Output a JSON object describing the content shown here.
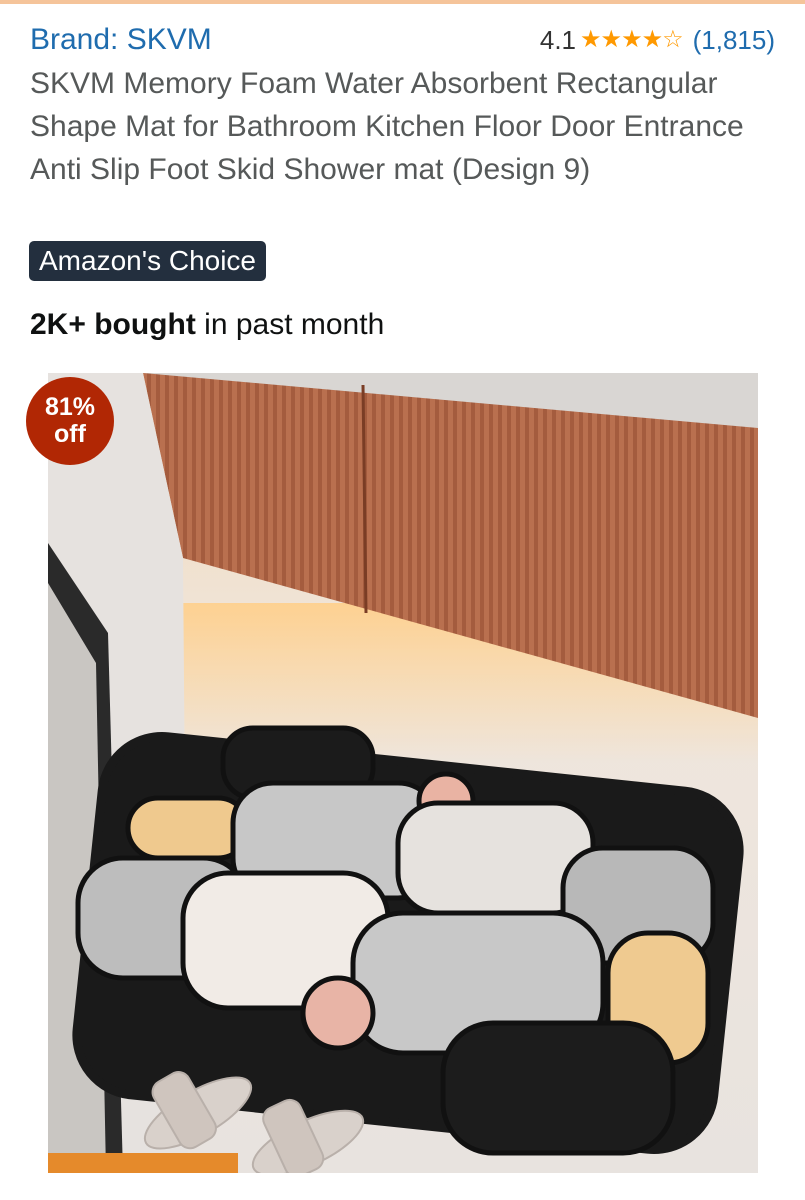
{
  "brand": {
    "label": "Brand: SKVM"
  },
  "rating": {
    "value": "4.1",
    "stars": 4.1,
    "count": "(1,815)"
  },
  "product": {
    "title": "SKVM Memory Foam Water Absorbent Rectangular Shape Mat for Bathroom Kitchen Floor Door Entrance Anti Slip Foot Skid Shower mat (Design 9)"
  },
  "badge": {
    "label": "Amazon's Choice"
  },
  "sales": {
    "bold": "2K+ bought",
    "rest": " in past month"
  },
  "discount": {
    "percent": "81%",
    "suffix": "off"
  },
  "icons": {
    "star": "star-icon",
    "star_empty": "star-outline-icon"
  },
  "colors": {
    "brand_link": "#1f6cae",
    "star": "#ff9900",
    "badge_bg": "#232f3e",
    "discount_bg": "#b12704"
  }
}
